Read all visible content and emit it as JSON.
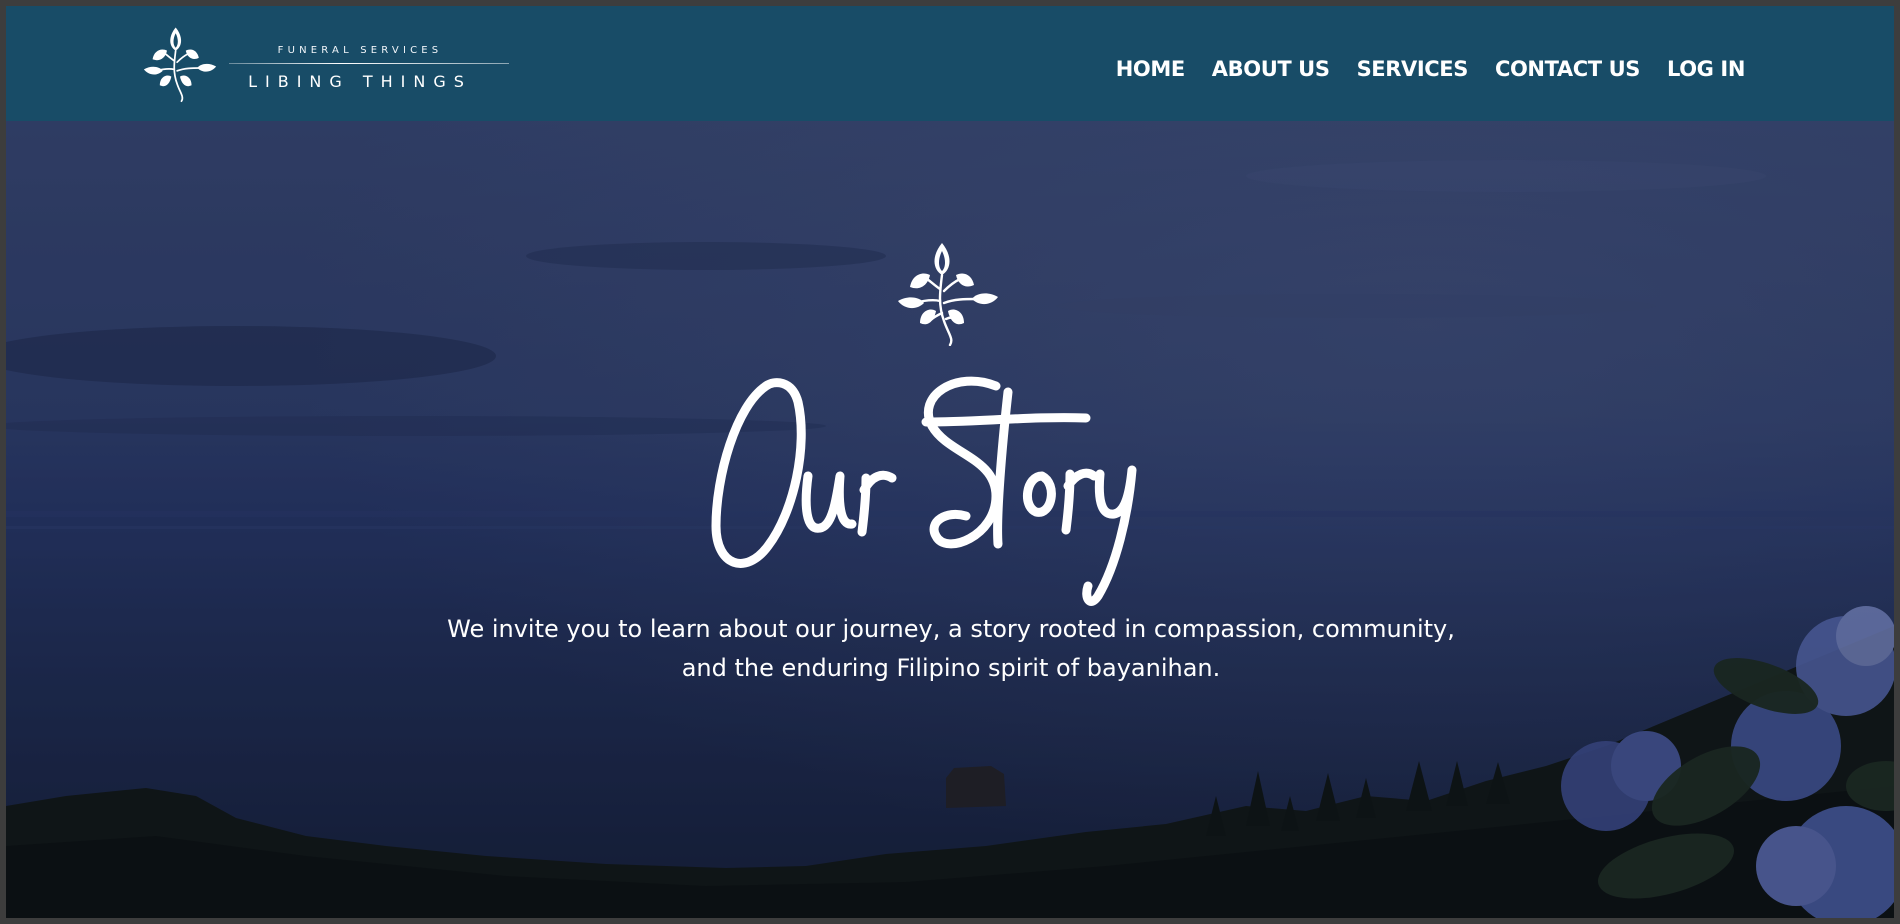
{
  "brand": {
    "subtitle": "FUNERAL SERVICES",
    "name": "LIBING THINGS",
    "logo_icon": "leaf-sprig-icon"
  },
  "nav": {
    "items": [
      {
        "label": "HOME"
      },
      {
        "label": "ABOUT US"
      },
      {
        "label": "SERVICES"
      },
      {
        "label": "CONTACT US"
      },
      {
        "label": "LOG IN"
      }
    ]
  },
  "hero": {
    "emblem_icon": "leaf-sprig-icon",
    "title": "Our Story",
    "text_line1": "We invite you to learn about our journey, a story rooted in compassion, community,",
    "text_line2": "and the enduring Filipino spirit of bayanihan."
  },
  "colors": {
    "navbar": "#184c67",
    "text": "#ffffff",
    "sky": "#2e3c66",
    "sea": "#1b2545"
  }
}
